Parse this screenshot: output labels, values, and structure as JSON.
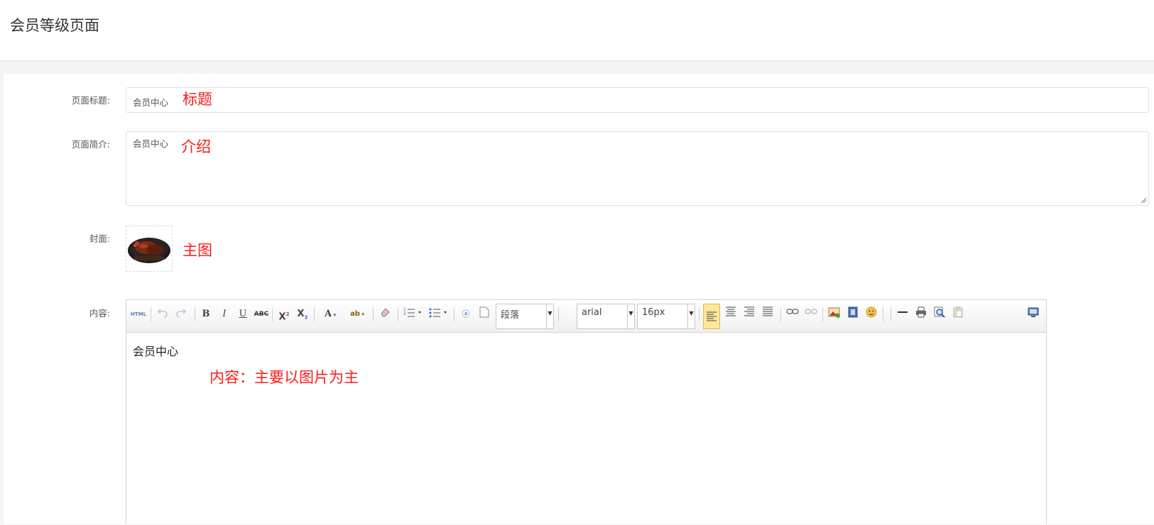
{
  "header": {
    "title": "会员等级页面"
  },
  "form": {
    "title_field": {
      "label": "页面标题:",
      "value": "会员中心",
      "annotation": "标题"
    },
    "intro_field": {
      "label": "页面简介:",
      "value": "会员中心",
      "annotation": "介绍"
    },
    "cover_field": {
      "label": "封面:",
      "annotation": "主图"
    },
    "content_field": {
      "label": "内容:",
      "annotation": "内容：主要以图片为主"
    }
  },
  "editor": {
    "toolbar": {
      "html_label": "HTML",
      "paragraph_value": "段落",
      "font_value": "arial",
      "size_value": "16px"
    },
    "body_text": "会员中心"
  },
  "colors": {
    "annotation": "#ff1a1a",
    "accent": "#ffe69b"
  }
}
